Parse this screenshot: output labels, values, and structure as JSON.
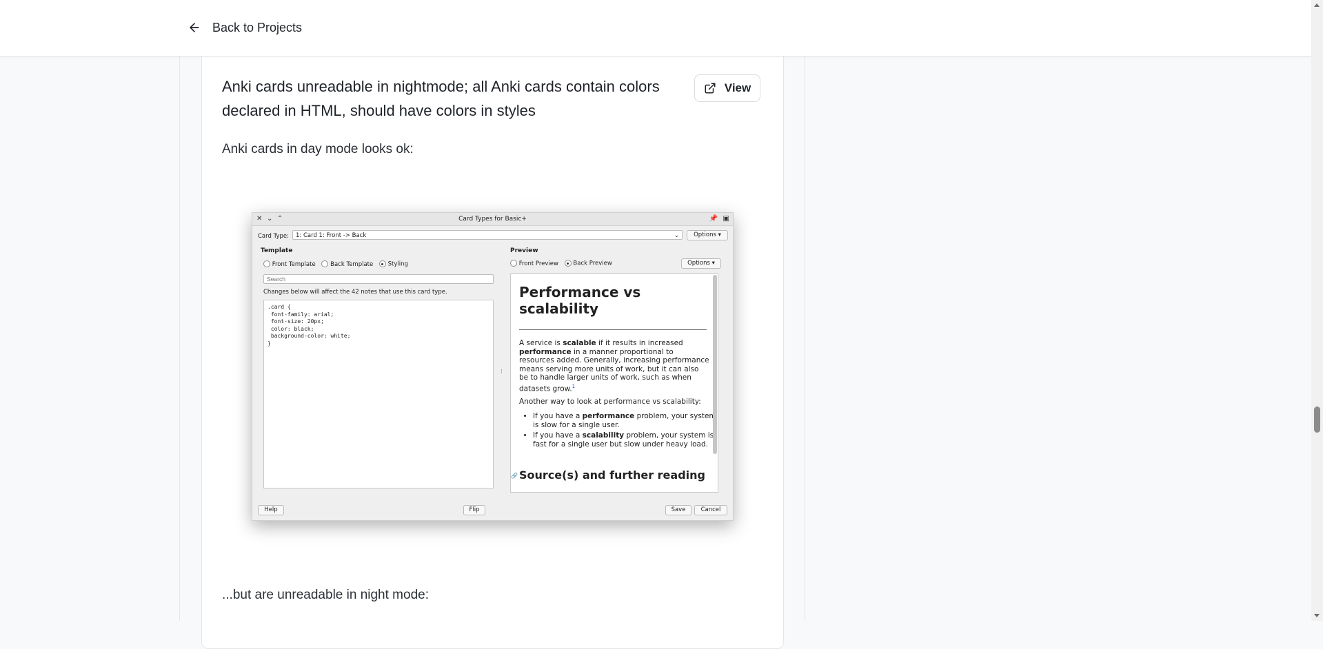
{
  "header": {
    "back_label": "Back to Projects"
  },
  "issue": {
    "title": "Anki cards unreadable in nightmode; all Anki cards contain colors declared in HTML, should have colors in styles",
    "view_label": "View",
    "intro": "Anki cards in day mode looks ok:",
    "outro": "...but are unreadable in night mode:"
  },
  "screenshot": {
    "window_title": "Card Types for Basic+",
    "card_type_label": "Card Type:",
    "card_type_value": "1: Card 1: Front -> Back",
    "options_label": "Options ▾",
    "template_heading": "Template",
    "preview_heading": "Preview",
    "front_template": "Front Template",
    "back_template": "Back Template",
    "styling": "Styling",
    "front_preview": "Front Preview",
    "back_preview": "Back Preview",
    "search_placeholder": "Search",
    "notice": "Changes below will affect the 42 notes that use this card type.",
    "css_code": ".card {\n font-family: arial;\n font-size: 20px;\n color: black;\n background-color: white;\n}",
    "preview_title": "Performance vs scalability",
    "preview_p1_a": "A service is ",
    "preview_p1_b": "scalable",
    "preview_p1_c": " if it results in increased ",
    "preview_p1_d": "performance",
    "preview_p1_e": " in a manner proportional to resources added. Generally, increasing performance means serving more units of work, but it can also be to handle larger units of work, such as when datasets grow.",
    "preview_p1_sup": "1",
    "preview_p2": "Another way to look at performance vs scalability:",
    "bullet1_a": "If you have a ",
    "bullet1_b": "performance",
    "bullet1_c": " problem, your system is slow for a single user.",
    "bullet2_a": "If you have a ",
    "bullet2_b": "scalability",
    "bullet2_c": " problem, your system is fast for a single user but slow under heavy load.",
    "preview_h2": "Source(s) and further reading",
    "help_label": "Help",
    "flip_label": "Flip",
    "save_label": "Save",
    "cancel_label": "Cancel"
  },
  "colors": {
    "accent_link": "#1a56db",
    "page_bg": "#f8f9fa"
  }
}
